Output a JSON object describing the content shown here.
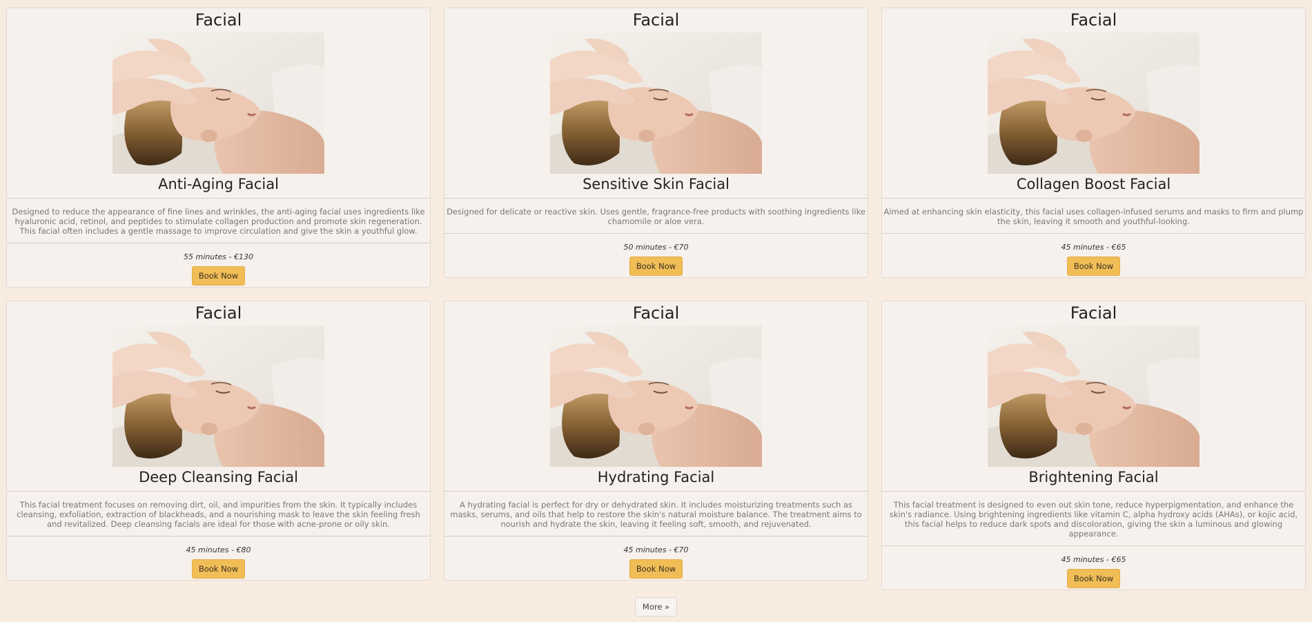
{
  "cards": [
    {
      "category": "Facial",
      "photo": "woman-receiving-facial-massage-photo",
      "name": "Anti-Aging Facial",
      "description": "Designed to reduce the appearance of fine lines and wrinkles, the anti-aging facial uses ingredients like hyaluronic acid, retinol, and peptides to stimulate collagen production and promote skin regeneration. This facial often includes a gentle massage to improve circulation and give the skin a youthful glow.",
      "meta": "55 minutes - €130",
      "button": "Book Now"
    },
    {
      "category": "Facial",
      "photo": "woman-receiving-facial-massage-photo",
      "name": "Sensitive Skin Facial",
      "description": "Designed for delicate or reactive skin. Uses gentle, fragrance-free products with soothing ingredients like chamomile or aloe vera.",
      "meta": "50 minutes - €70",
      "button": "Book Now"
    },
    {
      "category": "Facial",
      "photo": "woman-receiving-facial-massage-photo",
      "name": "Collagen Boost Facial",
      "description": "Aimed at enhancing skin elasticity, this facial uses collagen-infused serums and masks to firm and plump the skin, leaving it smooth and youthful-looking.",
      "meta": "45 minutes - €65",
      "button": "Book Now"
    },
    {
      "category": "Facial",
      "photo": "woman-receiving-facial-massage-photo",
      "name": "Deep Cleansing Facial",
      "description": "This facial treatment focuses on removing dirt, oil, and impurities from the skin. It typically includes cleansing, exfoliation, extraction of blackheads, and a nourishing mask to leave the skin feeling fresh and revitalized. Deep cleansing facials are ideal for those with acne-prone or oily skin.",
      "meta": "45 minutes - €80",
      "button": "Book Now"
    },
    {
      "category": "Facial",
      "photo": "woman-receiving-facial-massage-photo",
      "name": "Hydrating Facial",
      "description": "A hydrating facial is perfect for dry or dehydrated skin. It includes moisturizing treatments such as masks, serums, and oils that help to restore the skin's natural moisture balance. The treatment aims to nourish and hydrate the skin, leaving it feeling soft, smooth, and rejuvenated.",
      "meta": "45 minutes - €70",
      "button": "Book Now"
    },
    {
      "category": "Facial",
      "photo": "woman-receiving-facial-massage-photo",
      "name": "Brightening Facial",
      "description": "This facial treatment is designed to even out skin tone, reduce hyperpigmentation, and enhance the skin's radiance. Using brightening ingredients like vitamin C, alpha hydroxy acids (AHAs), or kojic acid, this facial helps to reduce dark spots and discoloration, giving the skin a luminous and glowing appearance.",
      "meta": "45 minutes - €65",
      "button": "Book Now"
    }
  ],
  "pagination": {
    "more_label": "More »"
  },
  "colors": {
    "page_background": "#f8ebe0",
    "card_background": "#f7f1ed",
    "button_accent": "#f0bd57"
  }
}
